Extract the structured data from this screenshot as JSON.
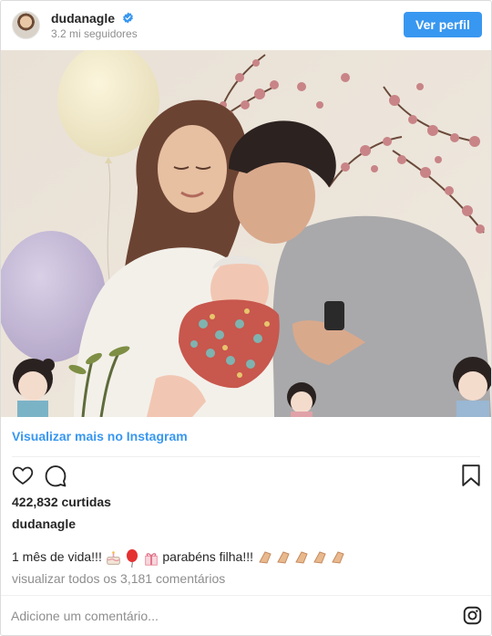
{
  "header": {
    "username": "dudanagle",
    "followers": "3.2 mi seguidores",
    "view_profile_label": "Ver perfil"
  },
  "post": {
    "image_alt": "Foto de família com bebê",
    "view_more_label": "Visualizar mais no Instagram",
    "likes": "422,832 curtidas",
    "author": "dudanagle",
    "caption_text_1": "1 mês de vida!!!",
    "caption_text_2": "parabéns filha!!!",
    "comments_link": "visualizar todos os 3,181 comentários"
  },
  "comment_box": {
    "placeholder": "Adicione um comentário..."
  },
  "colors": {
    "accent": "#3897f0",
    "text": "#262626",
    "muted": "#8e8e8e"
  },
  "icons": [
    "verified-badge-icon",
    "heart-icon",
    "comment-icon",
    "bookmark-icon",
    "instagram-logo-icon"
  ]
}
